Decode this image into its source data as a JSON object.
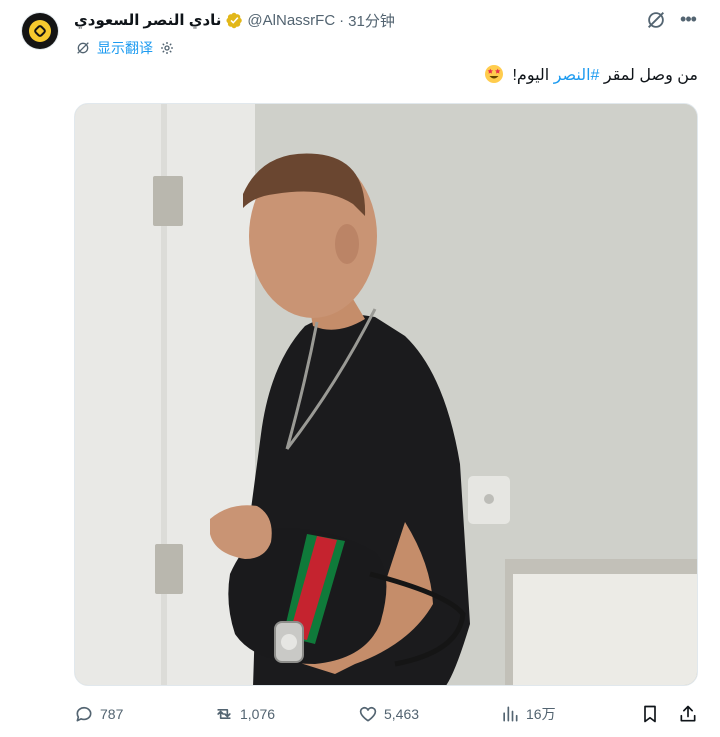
{
  "tweet": {
    "author_name": "نادي النصر السعودي",
    "handle": "@AlNassrFC",
    "separator": "·",
    "time": "31分钟",
    "translate_label": "显示翻译",
    "text_before": "من وصل لمقر ",
    "hashtag": "#النصر",
    "text_after": " اليوم!",
    "emoji": "star-struck-emoji"
  },
  "media": {
    "description_icon": "photo"
  },
  "actions": {
    "replies": "787",
    "reposts": "1,076",
    "likes": "5,463",
    "views": "16万"
  },
  "colors": {
    "accent": "#1d9bf0",
    "text_secondary": "#536471",
    "verified_gold": "#e2b719"
  }
}
